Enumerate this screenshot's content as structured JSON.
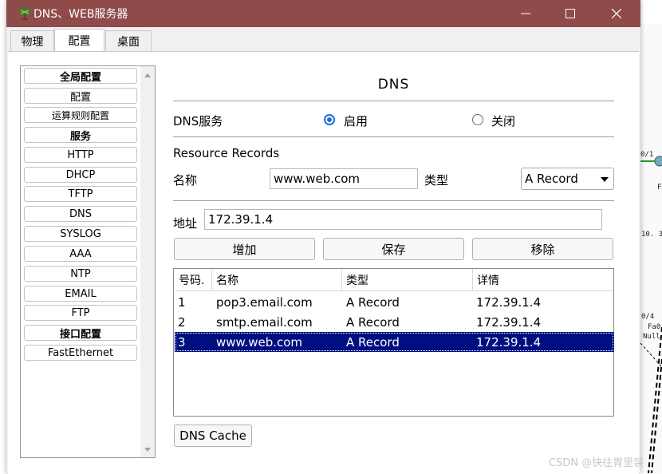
{
  "window": {
    "title": "DNS、WEB服务器",
    "titlebar_color": "#8f4a4a",
    "controls": [
      "minimize-icon",
      "maximize-icon",
      "close-icon"
    ]
  },
  "tabs": [
    {
      "label": "物理",
      "active": false
    },
    {
      "label": "配置",
      "active": true
    },
    {
      "label": "桌面",
      "active": false
    }
  ],
  "sidebar": {
    "items": [
      {
        "label": "全局配置",
        "type": "header"
      },
      {
        "label": "配置",
        "type": "item"
      },
      {
        "label": "运算规则配置",
        "type": "item"
      },
      {
        "label": "服务",
        "type": "header"
      },
      {
        "label": "HTTP",
        "type": "item"
      },
      {
        "label": "DHCP",
        "type": "item"
      },
      {
        "label": "TFTP",
        "type": "item"
      },
      {
        "label": "DNS",
        "type": "item"
      },
      {
        "label": "SYSLOG",
        "type": "item"
      },
      {
        "label": "AAA",
        "type": "item"
      },
      {
        "label": "NTP",
        "type": "item"
      },
      {
        "label": "EMAIL",
        "type": "item"
      },
      {
        "label": "FTP",
        "type": "item"
      },
      {
        "label": "接口配置",
        "type": "header"
      },
      {
        "label": "FastEthernet",
        "type": "item"
      }
    ]
  },
  "dns": {
    "title": "DNS",
    "service_label": "DNS服务",
    "on_label": "启用",
    "off_label": "关闭",
    "service_state": "on",
    "accent_color": "#1f6fd6",
    "resource_records_label": "Resource Records",
    "name_label": "名称",
    "name_value": "www.web.com",
    "type_label": "类型",
    "type_value": "A Record",
    "address_label": "地址",
    "address_value": "172.39.1.4",
    "buttons": {
      "add": "增加",
      "save": "保存",
      "remove": "移除"
    },
    "cache_button": "DNS Cache"
  },
  "records": {
    "columns": [
      "号码.",
      "名称",
      "类型",
      "详情"
    ],
    "rows": [
      [
        "1",
        "pop3.email.com",
        "A Record",
        "172.39.1.4"
      ],
      [
        "2",
        "smtp.email.com",
        "A Record",
        "172.39.1.4"
      ],
      [
        "3",
        "www.web.com",
        "A Record",
        "172.39.1.4"
      ]
    ],
    "selected_row": 3,
    "selected_color": "#000f80"
  },
  "background": {
    "texts": [
      "0/1",
      "F",
      "10. 39",
      "0/4",
      "Fa0",
      "Null"
    ]
  },
  "watermark": "CSDN @快往胃里装"
}
